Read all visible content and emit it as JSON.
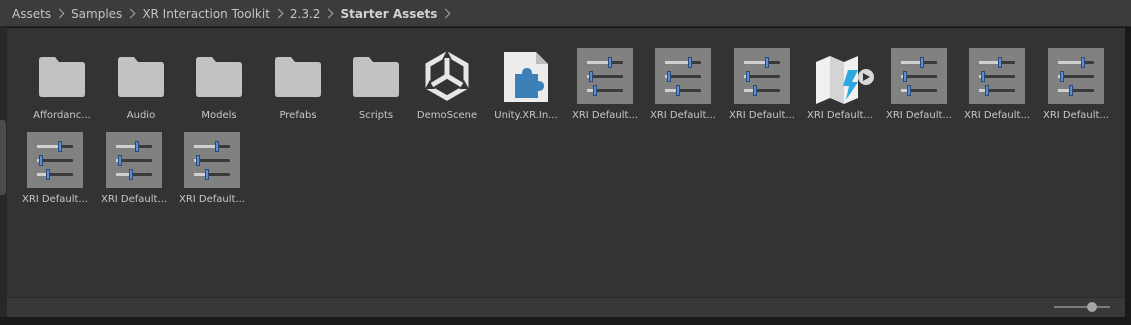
{
  "breadcrumb": {
    "items": [
      "Assets",
      "Samples",
      "XR Interaction Toolkit",
      "2.3.2",
      "Starter Assets"
    ]
  },
  "grid": {
    "items": [
      {
        "label": "Affordanc...",
        "icon": "folder-icon"
      },
      {
        "label": "Audio",
        "icon": "folder-icon"
      },
      {
        "label": "Models",
        "icon": "folder-icon"
      },
      {
        "label": "Prefabs",
        "icon": "folder-icon"
      },
      {
        "label": "Scripts",
        "icon": "folder-icon"
      },
      {
        "label": "DemoScene",
        "icon": "unity-scene-icon"
      },
      {
        "label": "Unity.XR.In...",
        "icon": "assembly-definition-icon"
      },
      {
        "label": "XRI Default...",
        "icon": "preset-icon"
      },
      {
        "label": "XRI Default...",
        "icon": "preset-icon"
      },
      {
        "label": "XRI Default...",
        "icon": "preset-icon"
      },
      {
        "label": "XRI Default...",
        "icon": "lighting-map-icon"
      },
      {
        "label": "XRI Default...",
        "icon": "preset-icon"
      },
      {
        "label": "XRI Default...",
        "icon": "preset-icon"
      },
      {
        "label": "XRI Default...",
        "icon": "preset-icon"
      },
      {
        "label": "XRI Default...",
        "icon": "preset-icon"
      },
      {
        "label": "XRI Default...",
        "icon": "preset-icon"
      },
      {
        "label": "XRI Default...",
        "icon": "preset-icon"
      }
    ]
  },
  "colors": {
    "folder": "#c2c2c2",
    "preset_background": "#818181",
    "slider_knob": "#5a8fd6",
    "assembly_icon": "#3d7fb8",
    "lighting_bolt": "#2ba8e0"
  }
}
